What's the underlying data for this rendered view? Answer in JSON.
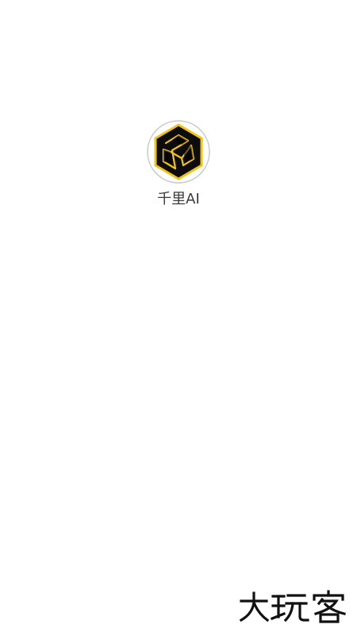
{
  "splash": {
    "app_name": "千里AI",
    "logo_icon": "hexagon-knot-logo-icon",
    "accent_color": "#f2c21b",
    "logo_fill": "#0d0d0d",
    "ring_color": "#bdbdbd"
  },
  "brand": {
    "text": "大玩客",
    "icon": "dawanke-brand-mark",
    "color": "#111111"
  }
}
